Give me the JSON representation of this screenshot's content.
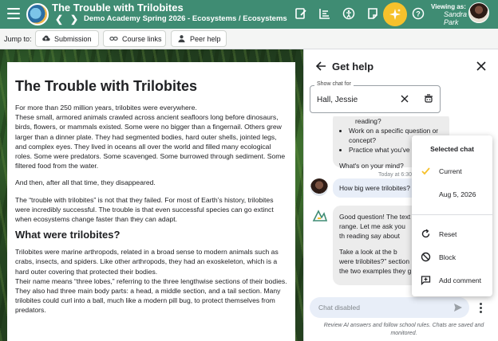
{
  "topbar": {
    "title": "The Trouble with Trilobites",
    "breadcrumb": "Demo Academy Spring 2026 - Ecosystems / Ecosystems",
    "viewing_label": "Viewing as:",
    "viewer_name": "Sandra Park",
    "accent_color": "#3f8c73",
    "sparkle_color": "#f6c12c"
  },
  "jumpbar": {
    "label": "Jump to:",
    "buttons": [
      {
        "label": "Submission",
        "icon": "cloud-upload-icon"
      },
      {
        "label": "Course links",
        "icon": "link-icon"
      },
      {
        "label": "Peer help",
        "icon": "person-icon"
      }
    ]
  },
  "article": {
    "title": "The Trouble with Trilobites",
    "p1": "For more than 250 million years, trilobites were everywhere.",
    "p2": "These small, armored animals crawled across ancient seafloors long before dinosaurs, birds, flowers, or mammals existed. Some were no bigger than a fingernail. Others grew larger than a dinner plate. They had segmented bodies, hard outer shells, jointed legs, and complex eyes. They lived in oceans all over the world and filled many ecological roles. Some were predators. Some scavenged. Some burrowed through sediment. Some filtered food from the water.",
    "p3": "And then, after all that time, they disappeared.",
    "p4": "The “trouble with trilobites” is not that they failed. For most of Earth’s history, trilobites were incredibly successful. The trouble is that even successful species can go extinct when ecosystems change faster than they can adapt.",
    "h2": "What were trilobites?",
    "p5": "Trilobites were marine arthropods, related in a broad sense to modern animals such as crabs, insects, and spiders. Like other arthropods, they had an exoskeleton, which is a hard outer covering that protected their bodies.",
    "p6": "Their name means “three lobes,” referring to the three lengthwise sections of their bodies. They also had three main body parts: a head, a middle section, and a tail section. Many trilobites could curl into a ball, much like a modern pill bug, to protect themselves from predators."
  },
  "panel": {
    "title": "Get help",
    "field_label": "Show chat for",
    "field_value": "Hall, Jessie",
    "bot_msg1": {
      "partial": "reading?",
      "bullets": [
        "Work on a specific question or concept?",
        "Practice what you've learned?"
      ],
      "question": "What's on your mind?"
    },
    "timestamp": "Today at 6:30",
    "user_msg": "How big were trilobites?",
    "bot_msg2_p1": "Good question! The text range. Let me ask you th reading say about their s",
    "bot_msg2_p2": "Take a look at the b were trilobites?” section the two examples they g",
    "input_placeholder": "Chat disabled",
    "disclaimer": "Review AI answers and follow school rules. Chats are saved and monitored."
  },
  "menu": {
    "header": "Selected chat",
    "items": [
      {
        "label": "Current",
        "icon": "check-icon"
      },
      {
        "label": "Aug 5, 2026",
        "icon": ""
      },
      {
        "label": "Reset",
        "icon": "reset-icon"
      },
      {
        "label": "Block",
        "icon": "block-icon"
      },
      {
        "label": "Add comment",
        "icon": "add-comment-icon"
      }
    ]
  }
}
